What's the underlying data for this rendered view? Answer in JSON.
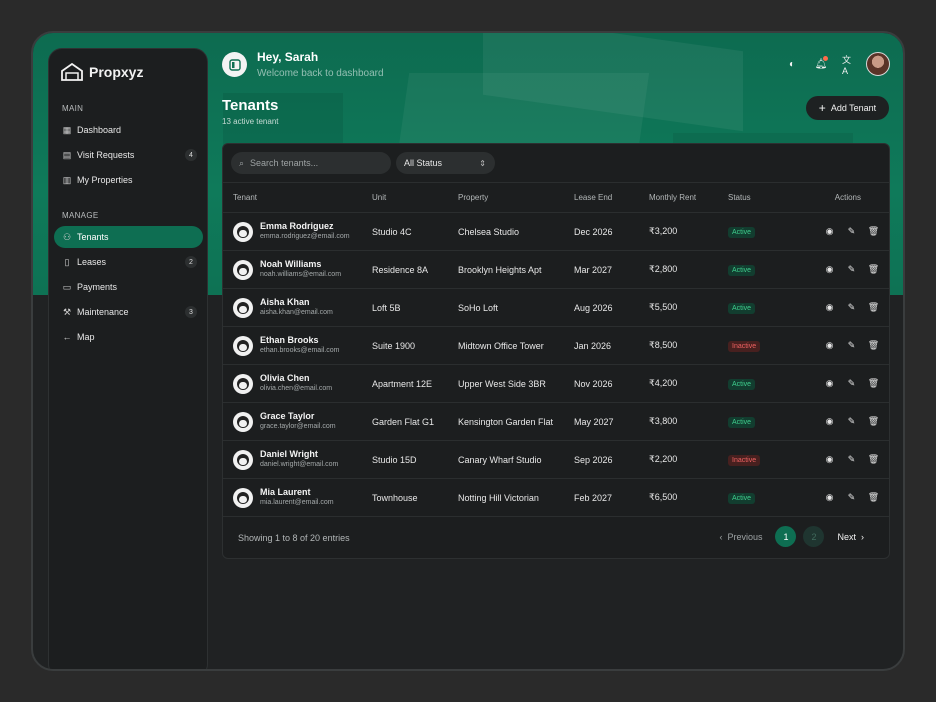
{
  "brand": {
    "name": "Propxyz"
  },
  "sidebar": {
    "main_label": "MAIN",
    "manage_label": "MANAGE",
    "main_items": [
      {
        "label": "Dashboard",
        "icon": "grid-icon",
        "count": ""
      },
      {
        "label": "Visit Requests",
        "icon": "calendar-icon",
        "count": "4"
      },
      {
        "label": "My Properties",
        "icon": "building-icon",
        "count": ""
      }
    ],
    "manage_items": [
      {
        "label": "Tenants",
        "icon": "users-icon",
        "count": ""
      },
      {
        "label": "Leases",
        "icon": "file-icon",
        "count": "2"
      },
      {
        "label": "Payments",
        "icon": "card-icon",
        "count": ""
      },
      {
        "label": "Maintenance",
        "icon": "wrench-icon",
        "count": "3"
      },
      {
        "label": "Map",
        "icon": "arrow-left-icon",
        "count": ""
      }
    ]
  },
  "header": {
    "greeting": "Hey, Sarah",
    "subtitle": "Welcome back to dashboard"
  },
  "page": {
    "title": "Tenants",
    "subtitle": "13 active tenant",
    "add_label": "Add Tenant"
  },
  "filters": {
    "search_placeholder": "Search tenants...",
    "status_value": "All Status"
  },
  "table": {
    "headers": [
      "Tenant",
      "Unit",
      "Property",
      "Lease End",
      "Monthly Rent",
      "Status",
      "Actions"
    ],
    "rows": [
      {
        "name": "Emma Rodriguez",
        "email": "emma.rodriguez@email.com",
        "unit": "Studio 4C",
        "property": "Chelsea Studio",
        "lease_end": "Dec 2026",
        "rent": "₹3,200",
        "status": "Active"
      },
      {
        "name": "Noah Williams",
        "email": "noah.williams@email.com",
        "unit": "Residence 8A",
        "property": "Brooklyn Heights Apt",
        "lease_end": "Mar 2027",
        "rent": "₹2,800",
        "status": "Active"
      },
      {
        "name": "Aisha Khan",
        "email": "aisha.khan@email.com",
        "unit": "Loft 5B",
        "property": "SoHo Loft",
        "lease_end": "Aug 2026",
        "rent": "₹5,500",
        "status": "Active"
      },
      {
        "name": "Ethan Brooks",
        "email": "ethan.brooks@email.com",
        "unit": "Suite 1900",
        "property": "Midtown Office Tower",
        "lease_end": "Jan 2026",
        "rent": "₹8,500",
        "status": "Inactive"
      },
      {
        "name": "Olivia Chen",
        "email": "olivia.chen@email.com",
        "unit": "Apartment 12E",
        "property": "Upper West Side 3BR",
        "lease_end": "Nov 2026",
        "rent": "₹4,200",
        "status": "Active"
      },
      {
        "name": "Grace Taylor",
        "email": "grace.taylor@email.com",
        "unit": "Garden Flat G1",
        "property": "Kensington Garden Flat",
        "lease_end": "May 2027",
        "rent": "₹3,800",
        "status": "Active"
      },
      {
        "name": "Daniel Wright",
        "email": "daniel.wright@email.com",
        "unit": "Studio 15D",
        "property": "Canary Wharf Studio",
        "lease_end": "Sep 2026",
        "rent": "₹2,200",
        "status": "Inactive"
      },
      {
        "name": "Mia Laurent",
        "email": "mia.laurent@email.com",
        "unit": "Townhouse",
        "property": "Notting Hill Victorian",
        "lease_end": "Feb 2027",
        "rent": "₹6,500",
        "status": "Active"
      }
    ]
  },
  "footer": {
    "info": "Showing 1 to 8 of 20 entries",
    "prev_label": "Previous",
    "next_label": "Next",
    "pages": [
      "1",
      "2"
    ]
  },
  "colors": {
    "accent": "#0e6e52",
    "active_text": "#3fcf8e",
    "inactive_text": "#f06262"
  }
}
